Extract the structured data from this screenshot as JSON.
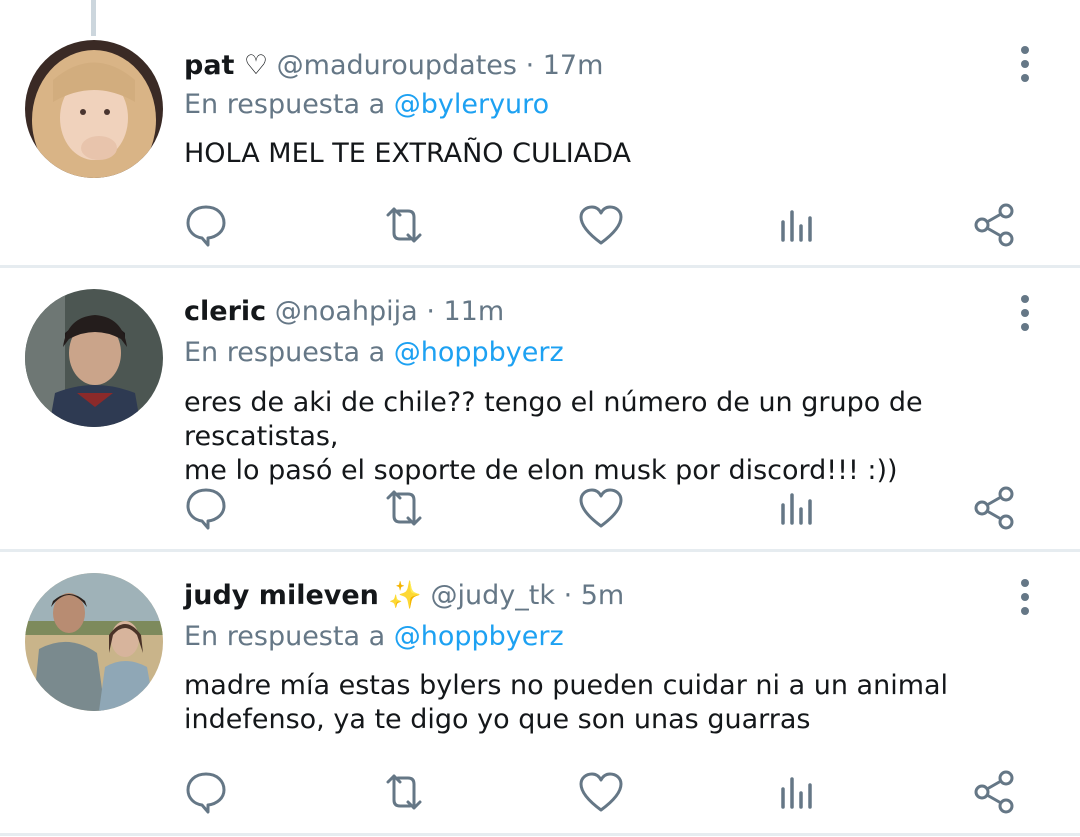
{
  "tweets": [
    {
      "name": "pat ♡",
      "handle": "@maduroupdates",
      "time": "· 17m",
      "reply_prefix": "En respuesta a",
      "reply_to": "@byleryuro",
      "text": "HOLA MEL TE EXTRAÑO CULIADA"
    },
    {
      "name": "cleric",
      "handle": "@noahpija",
      "time": "· 11m",
      "reply_prefix": "En respuesta a",
      "reply_to": "@hoppbyerz",
      "text": "eres de aki de chile?? tengo el número de un grupo de rescatistas,\nme lo pasó el soporte de elon musk por discord!!! :))"
    },
    {
      "name": "judy mileven ✨",
      "handle": "@judy_tk",
      "time": "· 5m",
      "reply_prefix": "En respuesta a",
      "reply_to": "@hoppbyerz",
      "text": "madre mía estas bylers no pueden cuidar ni a un animal\nindefenso, ya te digo yo que son unas guarras"
    }
  ],
  "icons": {
    "reply": "reply-icon",
    "retweet": "retweet-icon",
    "like": "heart-icon",
    "analytics": "analytics-icon",
    "share": "share-icon",
    "more": "more-vertical-icon"
  },
  "colors": {
    "text": "#14171a",
    "muted": "#657786",
    "link": "#1da1f2",
    "divider": "#e6ecf0"
  }
}
